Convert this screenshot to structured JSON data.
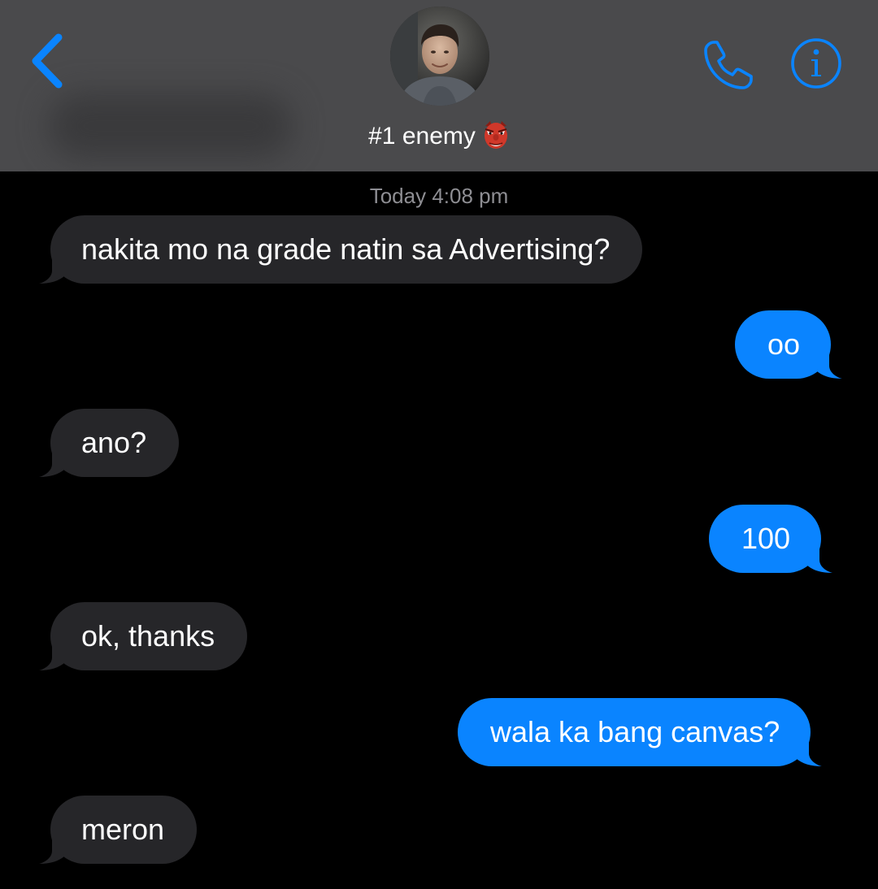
{
  "header": {
    "contact_name": "#1 enemy",
    "contact_emoji": "goblin-mask-emoji",
    "back_icon": "chevron-left-icon",
    "call_icon": "phone-icon",
    "info_icon": "info-icon",
    "accent_color": "#0a84ff",
    "background_color": "#4a4a4c"
  },
  "conversation": {
    "timestamp": "Today 4:08 pm",
    "messages": [
      {
        "direction": "received",
        "text": "nakita mo na grade natin sa Advertising?"
      },
      {
        "direction": "sent",
        "text": "oo"
      },
      {
        "direction": "received",
        "text": "ano?"
      },
      {
        "direction": "sent",
        "text": "100"
      },
      {
        "direction": "received",
        "text": "ok, thanks"
      },
      {
        "direction": "sent",
        "text": "wala ka bang canvas?"
      },
      {
        "direction": "received",
        "text": "meron"
      }
    ],
    "received_color": "#262629",
    "sent_color": "#0a84ff"
  }
}
